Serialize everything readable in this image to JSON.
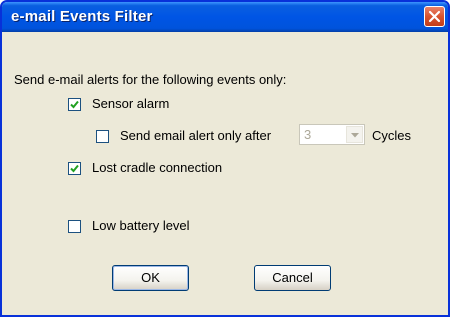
{
  "dialog": {
    "title": "e-mail Events Filter",
    "intro": "Send e-mail alerts for the following events only:",
    "options": [
      {
        "label": "Sensor alarm",
        "checked": true
      },
      {
        "label": "Send email alert only after",
        "checked": false,
        "enabled": false
      },
      {
        "label": "Lost cradle connection",
        "checked": true
      },
      {
        "label": "Low battery level",
        "checked": false
      }
    ],
    "cycles": {
      "value": "3",
      "suffix": "Cycles"
    },
    "buttons": {
      "ok": "OK",
      "cancel": "Cancel"
    }
  },
  "colors": {
    "titlebar": "#0055e5",
    "close_button": "#d8532f",
    "dialog_background": "#ece9d8",
    "check_mark": "#21a121"
  },
  "icons": {
    "close": "close-icon",
    "check": "check-icon",
    "dropdown": "chevron-down-icon"
  }
}
